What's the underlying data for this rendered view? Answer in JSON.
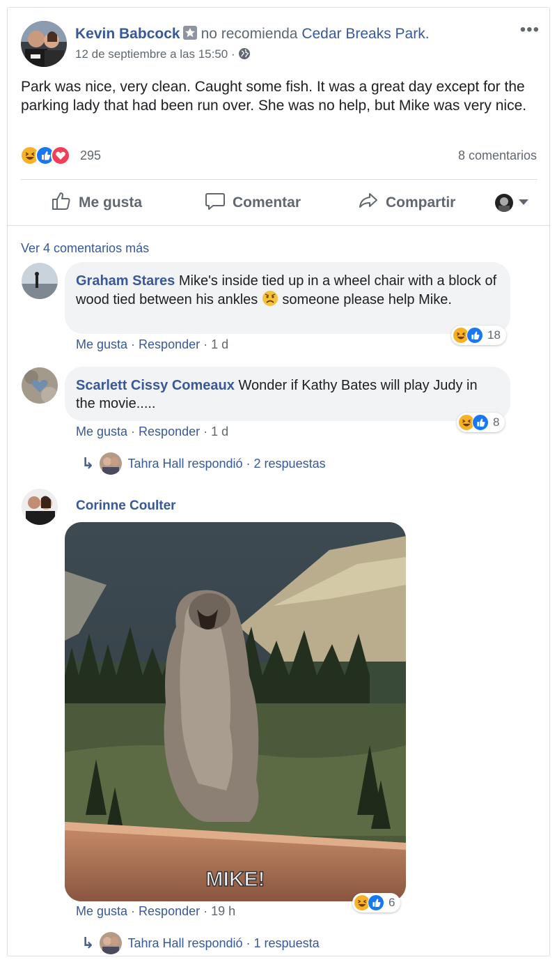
{
  "post": {
    "author": "Kevin Babcock",
    "verb": "no recomienda",
    "page": "Cedar Breaks Park.",
    "date": "12 de septiembre a las 15:50 ·",
    "text": "Park was nice, very clean. Caught some fish. It was a great day except for the parking lady that had been run over. She was no help, but Mike was very nice.",
    "reactions_count": "295",
    "comments_count": "8 comentarios"
  },
  "actions": {
    "like": "Me gusta",
    "comment": "Comentar",
    "share": "Compartir"
  },
  "comments_section": {
    "view_more": "Ver 4 comentarios más"
  },
  "comments": [
    {
      "author": "Graham Stares",
      "text_before": " Mike's inside tied up in a wheel chair with a block of wood tied between his ankles ",
      "text_after": " someone please help Mike.",
      "like": "Me gusta",
      "reply": "Responder",
      "time": "1 d",
      "reactions": "18"
    },
    {
      "author": "Scarlett Cissy Comeaux",
      "text": " Wonder if Kathy Bates will play Judy in the movie.....",
      "like": "Me gusta",
      "reply": "Responder",
      "time": "1 d",
      "reactions": "8",
      "reply_summary": "Tahra Hall respondió · 2 respuestas"
    },
    {
      "author": "Corinne Coulter",
      "gif_caption": "MIKE!",
      "like": "Me gusta",
      "reply": "Responder",
      "time": "19 h",
      "reactions": "6",
      "reply_summary": "Tahra Hall respondió · 1 respuesta"
    }
  ],
  "colors": {
    "link": "#385898",
    "muted": "#606770",
    "bubble": "#f2f3f5",
    "like_blue": "#1877f2",
    "haha_yellow": "#f7b125",
    "love_red": "#f33e58"
  }
}
